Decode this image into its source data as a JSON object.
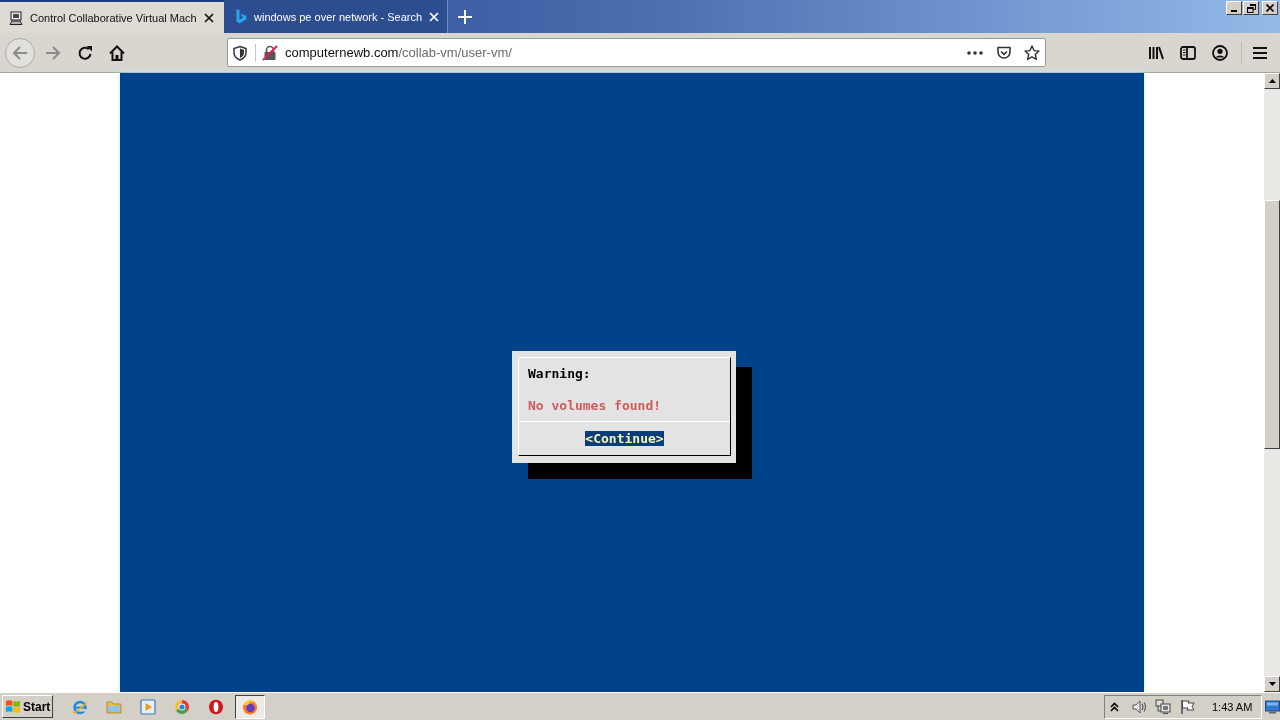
{
  "tabs": [
    {
      "kind": "computer",
      "title": "Control Collaborative Virtual Mach",
      "selected": true
    },
    {
      "kind": "b-logo",
      "title": "windows pe over network - Search",
      "selected": false
    }
  ],
  "address_bar": {
    "domain": "computernewb.com",
    "path": "/collab-vm/user-vm/"
  },
  "vm_screen": {
    "dialog": {
      "title": "Warning:",
      "message": "No volumes found!",
      "buttons": [
        {
          "label": "<Continue>",
          "selected": true
        }
      ]
    }
  },
  "taskbar": {
    "start_button": "Start",
    "apps": [
      {
        "kind": "e-logo",
        "selected": false
      },
      {
        "kind": "folder",
        "selected": false
      },
      {
        "kind": "play",
        "selected": false
      },
      {
        "kind": "ring-logo",
        "selected": false
      },
      {
        "kind": "o-logo",
        "selected": false
      },
      {
        "kind": "fox-logo",
        "selected": true
      }
    ],
    "clock": "1:43 AM"
  }
}
